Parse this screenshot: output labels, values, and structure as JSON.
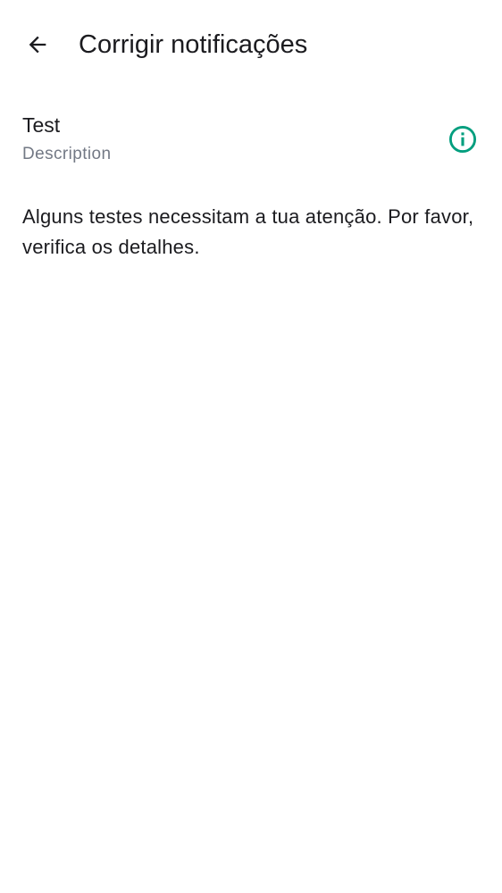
{
  "header": {
    "back_icon": "arrow-back-icon",
    "title": "Corrigir notificações"
  },
  "test_item": {
    "title": "Test",
    "description": "Description",
    "info_icon": "info-circle-icon",
    "accent_color": "#009e7e"
  },
  "message": "Alguns testes necessitam a tua atenção. Por favor, verifica os detalhes."
}
